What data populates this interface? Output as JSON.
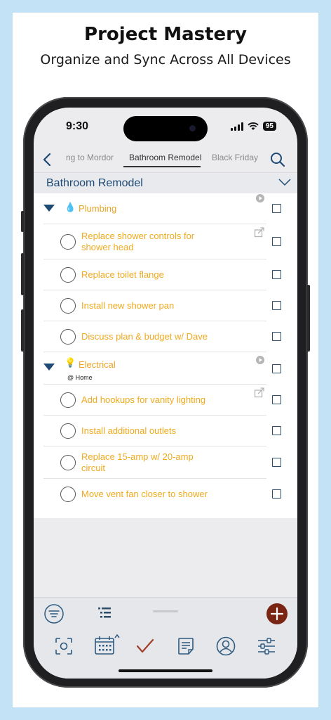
{
  "promo": {
    "title": "Project Mastery",
    "subtitle": "Organize and Sync Across All Devices"
  },
  "status_bar": {
    "time": "9:30",
    "battery": "95"
  },
  "tabs": [
    {
      "label": "ng to Mordor",
      "active": false
    },
    {
      "label": "Bathroom Remodel",
      "active": true
    },
    {
      "label": "Black Friday",
      "active": false
    }
  ],
  "section": {
    "title": "Bathroom Remodel"
  },
  "groups": [
    {
      "name": "Plumbing",
      "icon": "droplet-icon",
      "emoji": "💧",
      "context": "",
      "tasks": [
        {
          "label": "Replace shower controls for shower head"
        },
        {
          "label": "Replace toilet flange"
        },
        {
          "label": "Install new shower pan"
        },
        {
          "label": "Discuss plan & budget w/ Dave"
        }
      ]
    },
    {
      "name": "Electrical",
      "icon": "lightbulb-icon",
      "emoji": "💡",
      "context": "@ Home",
      "tasks": [
        {
          "label": "Add hookups for vanity lighting"
        },
        {
          "label": "Install additional outlets"
        },
        {
          "label": "Replace 15-amp w/ 20-amp circuit"
        },
        {
          "label": "Move vent fan closer to shower"
        }
      ]
    }
  ],
  "toolbar": {
    "top_icons": [
      "filter-icon",
      "outline-list-icon",
      "add-icon"
    ],
    "bottom_icons": [
      "focus-icon",
      "calendar-icon",
      "checkmark-icon",
      "notes-icon",
      "contacts-icon",
      "settings-sliders-icon"
    ]
  },
  "colors": {
    "task_text": "#f0a91e",
    "header_text": "#1e4a73",
    "add_button": "#7a2414",
    "background": "#c4e2f6"
  }
}
